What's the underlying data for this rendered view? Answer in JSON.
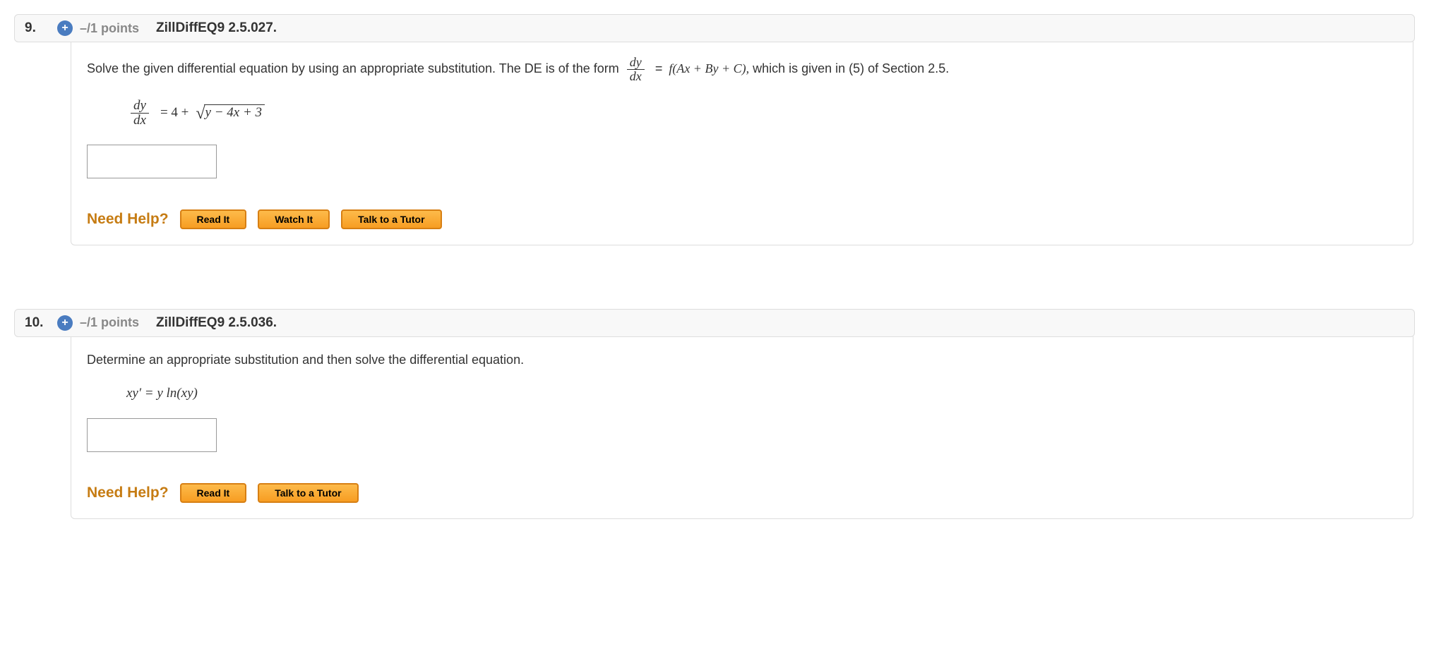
{
  "questions": [
    {
      "number": "9.",
      "points": "–/1 points",
      "assignment": "ZillDiffEQ9 2.5.027.",
      "problem": {
        "prefix": "Solve the given differential equation by using an appropriate substitution. The DE is of the form ",
        "frac_top": "dy",
        "frac_bot": "dx",
        "middle": " = ",
        "fexpr": "f(Ax + By + C),",
        "suffix": "  which is given in (5) of Section 2.5."
      },
      "equation": {
        "lhs_top": "dy",
        "lhs_bot": "dx",
        "rhs_before": "= 4 + ",
        "rad": "y − 4x + 3"
      },
      "help_label": "Need Help?",
      "buttons": {
        "read": "Read It",
        "watch": "Watch It",
        "tutor": "Talk to a Tutor"
      }
    },
    {
      "number": "10.",
      "points": "–/1 points",
      "assignment": "ZillDiffEQ9 2.5.036.",
      "problem": {
        "text": "Determine an appropriate substitution and then solve the differential equation."
      },
      "equation_text": "xy′ = y ln(xy)",
      "help_label": "Need Help?",
      "buttons": {
        "read": "Read It",
        "tutor": "Talk to a Tutor"
      }
    }
  ]
}
